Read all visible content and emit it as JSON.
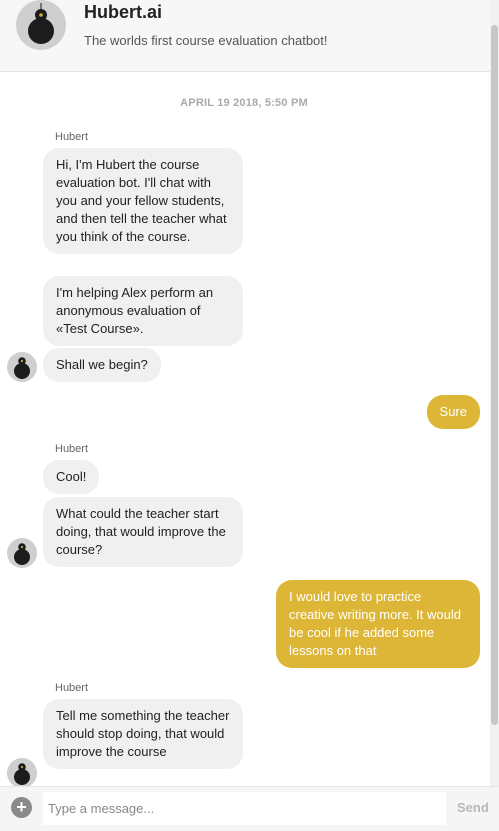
{
  "header": {
    "title": "Hubert.ai",
    "subtitle": "The worlds first course evaluation chatbot!"
  },
  "conversation": {
    "date_stamp": "APRIL 19 2018, 5:50 PM",
    "sender_name": "Hubert",
    "messages": [
      {
        "from": "bot",
        "text": "Hi, I'm Hubert the course evaluation bot. I'll chat with you and your fellow students, and then tell the teacher what you think of the course."
      },
      {
        "from": "bot",
        "text": "I'm helping Alex perform an anonymous evaluation of «Test Course»."
      },
      {
        "from": "bot",
        "text": "Shall we begin?"
      },
      {
        "from": "user",
        "text": "Sure"
      },
      {
        "from": "bot",
        "text": "Cool!"
      },
      {
        "from": "bot",
        "text": "What could the teacher start doing, that would improve the course?"
      },
      {
        "from": "user",
        "text": "I would love to practice creative writing more. It would be cool if he added some lessons on that"
      },
      {
        "from": "bot",
        "text": "Tell me something the teacher should stop doing, that would improve the course"
      }
    ]
  },
  "composer": {
    "add_icon": "plus-icon",
    "placeholder": "Type a message...",
    "send_label": "Send"
  },
  "colors": {
    "accent": "#ddb637",
    "bot_bubble": "#f0f0f0",
    "header_bg": "#f7f7f7"
  }
}
